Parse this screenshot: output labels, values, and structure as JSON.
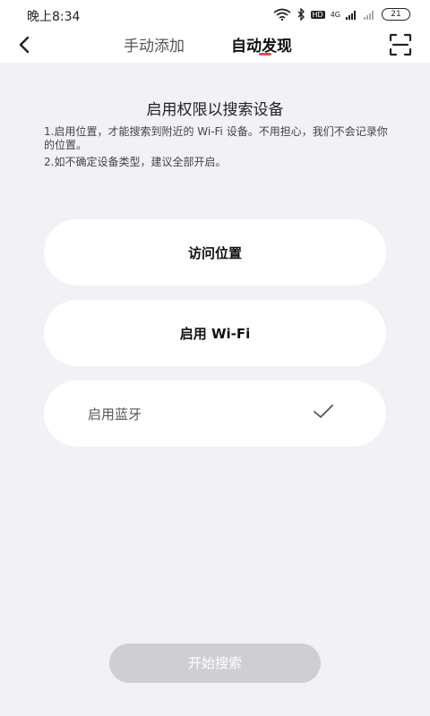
{
  "status_bar": {
    "time": "晚上8:34",
    "network": "4G",
    "hd": "HD",
    "battery": "21"
  },
  "nav": {
    "tabs": [
      {
        "label": "手动添加",
        "active": false
      },
      {
        "label": "自动发现",
        "active": true
      }
    ],
    "accent_color": "#e94c4c"
  },
  "main": {
    "heading": "启用权限以搜索设备",
    "notes": [
      "1.启用位置，才能搜索到附近的 Wi-Fi 设备。不用担心，我们不会记录你的位置。",
      "2.如不确定设备类型，建议全部开启。"
    ],
    "options": [
      {
        "label": "访问位置",
        "enabled": false
      },
      {
        "label": "启用 Wi-Fi",
        "enabled": false
      },
      {
        "label": "启用蓝牙",
        "enabled": true
      }
    ],
    "start_button": "开始搜索"
  }
}
